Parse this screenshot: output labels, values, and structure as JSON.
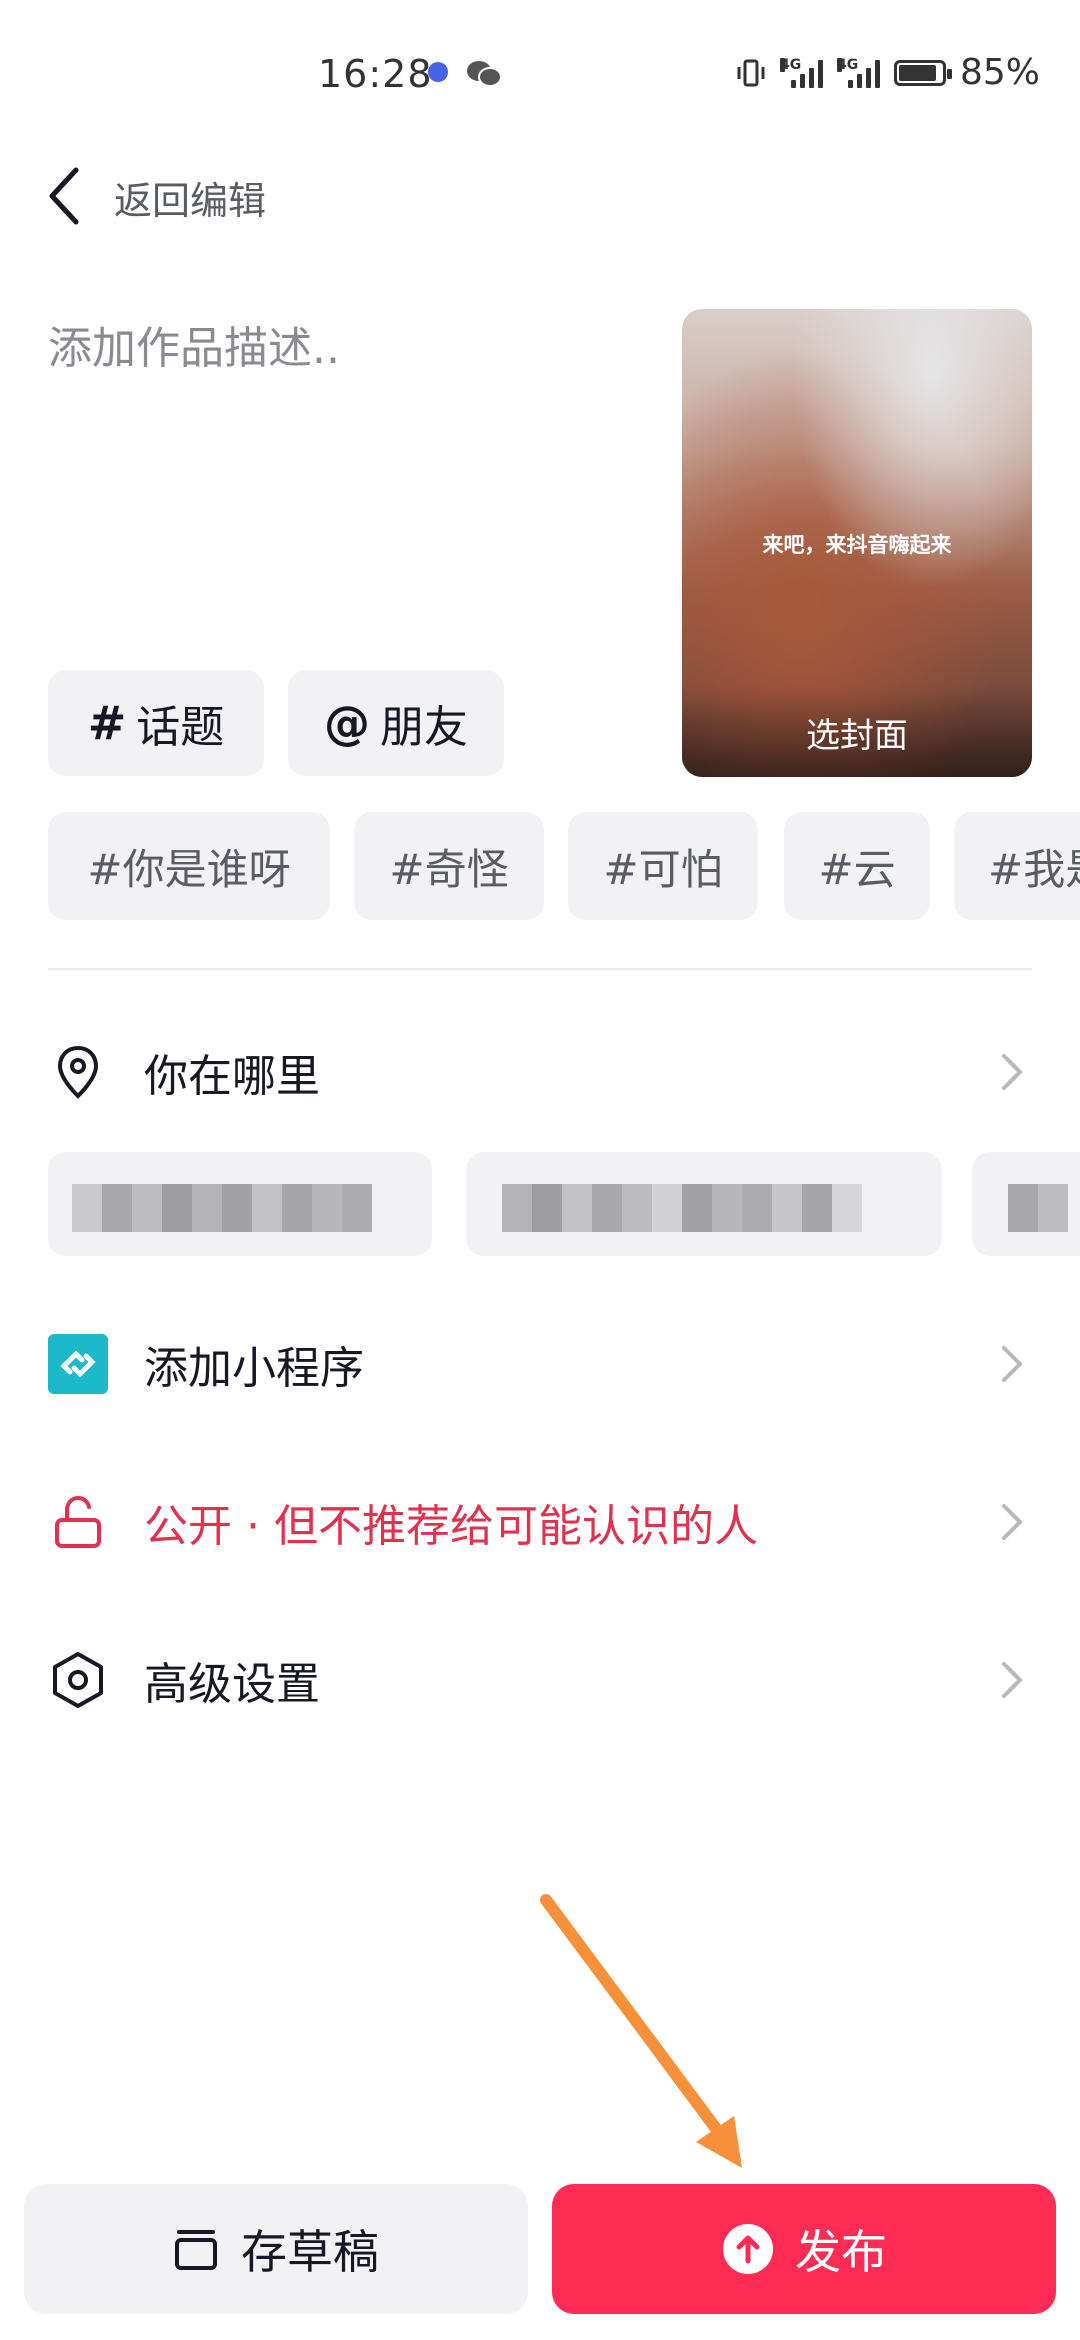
{
  "status_bar": {
    "time": "16:28",
    "battery": "85%",
    "network_1": "4G",
    "network_2": "4G"
  },
  "header": {
    "back_label": "返回编辑"
  },
  "description": {
    "placeholder": "添加作品描述.."
  },
  "cover": {
    "caption": "来吧，来抖音嗨起来",
    "select_label": "选封面"
  },
  "chips": {
    "topic": "话题",
    "topic_symbol": "#",
    "friend": "朋友",
    "friend_symbol": "@"
  },
  "suggested_tags": [
    "#你是谁呀",
    "#奇怪",
    "#可怕",
    "#云",
    "#我是"
  ],
  "rows": {
    "location": "你在哪里",
    "mini_program": "添加小程序",
    "visibility": "公开 · 但不推荐给可能认识的人",
    "advanced": "高级设置"
  },
  "colors": {
    "accent": "#fe2c55",
    "visibility": "#e0324f",
    "mini_program_icon": "#1bb9c9",
    "annotation_arrow": "#f7903a"
  },
  "buttons": {
    "draft": "存草稿",
    "publish": "发布"
  }
}
